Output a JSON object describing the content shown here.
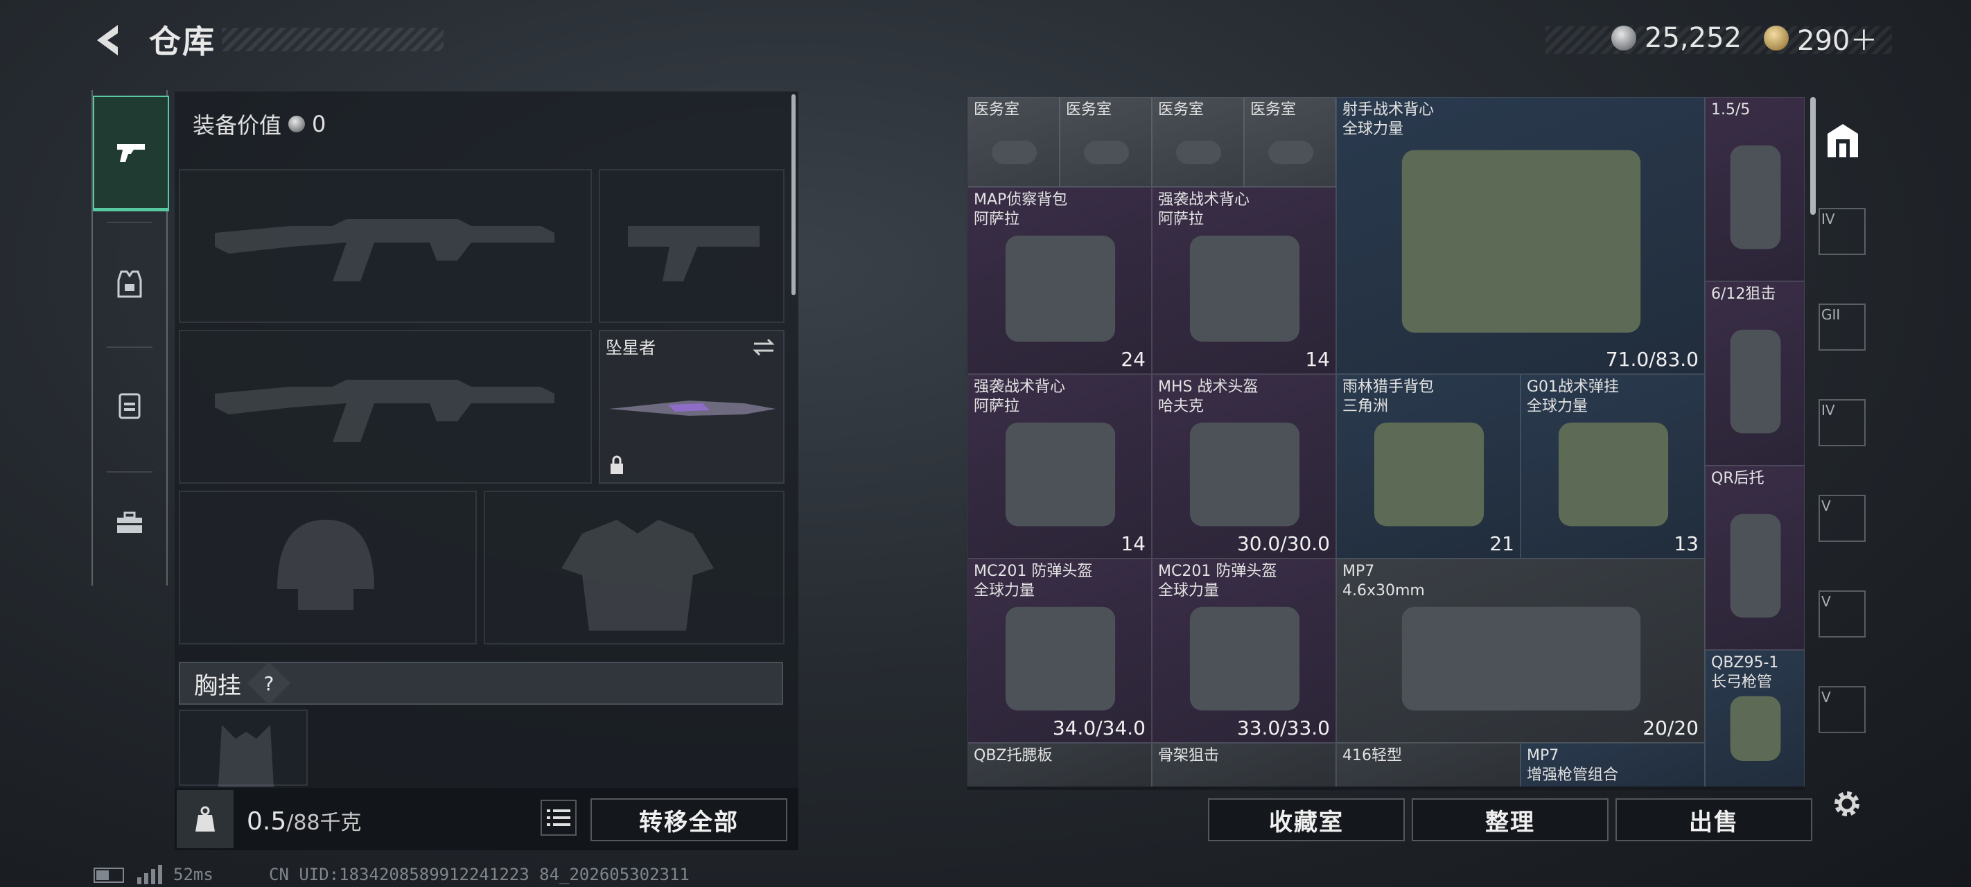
{
  "header": {
    "title": "仓库"
  },
  "currency": {
    "silver": "25,252",
    "gold": "290＋"
  },
  "left": {
    "equip_value_label": "装备价值",
    "equip_value": "0",
    "melee_name": "坠星者",
    "chest_label": "胸挂",
    "chest_help": "?",
    "weight_value": "0.5",
    "weight_max": "/88千克",
    "transfer_all": "转移全部"
  },
  "storage": {
    "items": [
      {
        "name1": "医务室",
        "name2": "",
        "value": "",
        "rarity": "white"
      },
      {
        "name1": "医务室",
        "name2": "",
        "value": "",
        "rarity": "white"
      },
      {
        "name1": "医务室",
        "name2": "",
        "value": "",
        "rarity": "white"
      },
      {
        "name1": "医务室",
        "name2": "",
        "value": "",
        "rarity": "white"
      },
      {
        "name1": "射手战术背心",
        "name2": "全球力量",
        "value": "71.0/83.0",
        "rarity": "blue"
      },
      {
        "name1": "1.5/5",
        "name2": "",
        "value": "",
        "rarity": "purple"
      },
      {
        "name1": "MAP侦察背包",
        "name2": "阿萨拉",
        "value": "24",
        "rarity": "purple"
      },
      {
        "name1": "强袭战术背心",
        "name2": "阿萨拉",
        "value": "14",
        "rarity": "purple"
      },
      {
        "name1": "6/12狙击",
        "name2": "",
        "value": "",
        "rarity": "purple"
      },
      {
        "name1": "强袭战术背心",
        "name2": "阿萨拉",
        "value": "14",
        "rarity": "purple"
      },
      {
        "name1": "MHS 战术头盔",
        "name2": "哈夫克",
        "value": "30.0/30.0",
        "rarity": "purple"
      },
      {
        "name1": "雨林猎手背包",
        "name2": "三角洲",
        "value": "21",
        "rarity": "blue"
      },
      {
        "name1": "G01战术弹挂",
        "name2": "全球力量",
        "value": "13",
        "rarity": "blue"
      },
      {
        "name1": "QR后托",
        "name2": "",
        "value": "",
        "rarity": "purple"
      },
      {
        "name1": "MC201 防弹头盔",
        "name2": "全球力量",
        "value": "34.0/34.0",
        "rarity": "purple"
      },
      {
        "name1": "MC201 防弹头盔",
        "name2": "全球力量",
        "value": "33.0/33.0",
        "rarity": "purple"
      },
      {
        "name1": "MP7",
        "name2": "4.6x30mm",
        "value": "20/20",
        "rarity": "grey"
      },
      {
        "name1": "QBZ95-1",
        "name2": "长弓枪管",
        "value": "",
        "rarity": "blue"
      },
      {
        "name1": "QBZ托腮板",
        "name2": "",
        "value": "",
        "rarity": "grey"
      },
      {
        "name1": "骨架狙击",
        "name2": "",
        "value": "",
        "rarity": "grey"
      },
      {
        "name1": "416轻型",
        "name2": "",
        "value": "",
        "rarity": "grey"
      },
      {
        "name1": "MP7",
        "name2": "增强枪管组合",
        "value": "",
        "rarity": "blue"
      }
    ]
  },
  "bottom": {
    "collection": "收藏室",
    "organize": "整理",
    "sell": "出售"
  },
  "status": {
    "ping": "52ms",
    "uid": "CN UID:1834208589912241223 84_202605302311"
  },
  "right_tabs": [
    "IV",
    "GII",
    "IV",
    "V",
    "V",
    "V"
  ],
  "colors": {
    "accent": "#58c9a1",
    "purple": "#3a2e47",
    "blue": "#2a3a4e"
  }
}
